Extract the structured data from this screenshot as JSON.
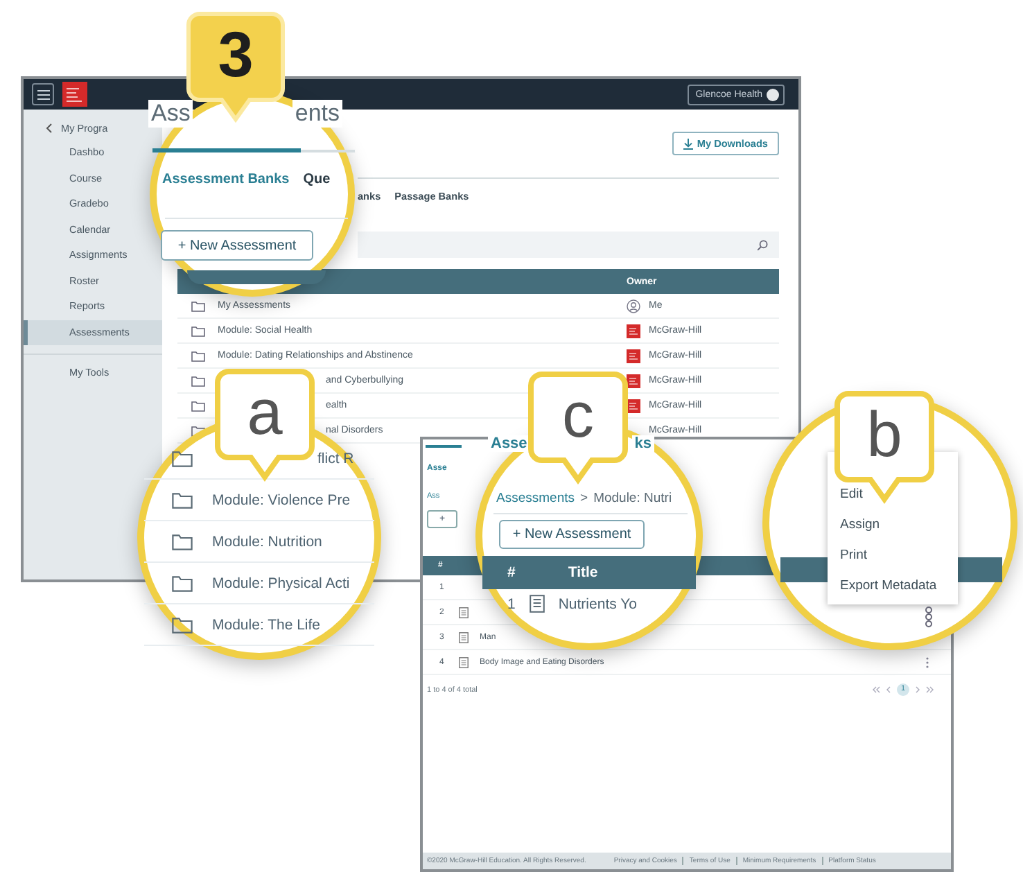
{
  "main_window": {
    "account_button": "Glencoe Health",
    "sidebar": {
      "back_item": "My Progra",
      "items": [
        {
          "label": "Dashbo",
          "selected": false
        },
        {
          "label": "Course",
          "selected": false
        },
        {
          "label": "Gradebo",
          "selected": false
        },
        {
          "label": "Calendar",
          "selected": false
        },
        {
          "label": "Assignments",
          "selected": false
        },
        {
          "label": "Roster",
          "selected": false
        },
        {
          "label": "Reports",
          "selected": false
        },
        {
          "label": "Assessments",
          "selected": true
        }
      ],
      "footer_item": "My Tools"
    },
    "downloads_button": "My Downloads",
    "tabs": [
      "anks",
      "Passage Banks"
    ],
    "table": {
      "columns": [
        "Owner"
      ],
      "rows": [
        {
          "kind": "own",
          "title": "My Assessments",
          "owner": "Me"
        },
        {
          "kind": "publisher",
          "title": "Module: Social Health",
          "owner": "McGraw-Hill"
        },
        {
          "kind": "publisher",
          "title": "Module: Dating Relationships and Abstinence",
          "owner": "McGraw-Hill"
        },
        {
          "kind": "publisher_partial",
          "title": "and Cyberbullying",
          "owner": "McGraw-Hill"
        },
        {
          "kind": "publisher_partial",
          "title": "ealth",
          "owner": "McGraw-Hill"
        },
        {
          "kind": "partial",
          "title": "nal Disorders",
          "owner": "McGraw-Hill"
        }
      ]
    }
  },
  "callout_3": {
    "badge": "3",
    "title_parts": [
      "Ass",
      "ents"
    ],
    "tabs": [
      {
        "label": "Assessment Banks",
        "selected": true
      },
      {
        "label": "Que",
        "selected": false
      }
    ],
    "new_button": "+ New Assessment"
  },
  "callout_a": {
    "badge": "a",
    "rows": [
      "flict R",
      "Module: Violence Pre",
      "Module: Nutrition",
      "Module: Physical Acti",
      "Module: The Life"
    ]
  },
  "detail_window": {
    "tab": "Asse",
    "breadcrumb": "Ass",
    "new_button": "+",
    "columns": [
      "#"
    ],
    "rows": [
      {
        "number": "1",
        "icon": false
      },
      {
        "number": "2",
        "icon": true
      },
      {
        "number": "3",
        "icon": true,
        "title": "Man"
      },
      {
        "number": "4",
        "icon": true,
        "title": "Body Image and Eating Disorders",
        "menu": true
      }
    ],
    "summary": "1 to 4 of 4 total",
    "pages": [
      {
        "label": "1",
        "selected": true
      }
    ],
    "footer": {
      "copyright": "©2020 McGraw-Hill Education. All Rights Reserved.",
      "links": [
        "Privacy and Cookies",
        "Terms of Use",
        "Minimum Requirements",
        "Platform Status"
      ]
    }
  },
  "callout_c": {
    "badge": "c",
    "title_parts": [
      "Asse",
      "ks"
    ],
    "breadcrumb": [
      {
        "label": "Assessments",
        "kind": "link"
      },
      {
        "label": ">",
        "kind": "separator"
      },
      {
        "label": "Module: Nutri",
        "kind": "current"
      }
    ],
    "new_button": "+ New Assessment",
    "columns": [
      "#",
      "Title"
    ],
    "row": {
      "number": "1",
      "title": "Nutrients Yo"
    }
  },
  "callout_b": {
    "badge": "b",
    "menu": [
      "Edit",
      "Assign",
      "Print",
      "Export Metadata"
    ]
  }
}
